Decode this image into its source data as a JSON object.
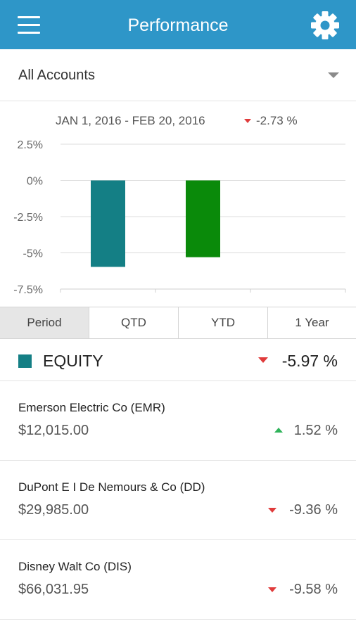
{
  "header": {
    "title": "Performance",
    "menu_icon": "hamburger-menu-icon",
    "settings_icon": "gear-icon",
    "bar_color": "#2e96c8"
  },
  "account_selector": {
    "selected": "All Accounts"
  },
  "summary": {
    "date_range": "JAN 1, 2016 - FEB 20, 2016",
    "change": "-2.73 %",
    "direction": "down"
  },
  "chart_data": {
    "type": "bar",
    "categories": [
      "",
      "",
      ""
    ],
    "values": [
      -5.97,
      -5.3,
      null
    ],
    "colors": [
      "#147f85",
      "#0a8a0a",
      null
    ],
    "ylim": [
      -7.5,
      2.5
    ],
    "yticks": [
      2.5,
      0,
      -2.5,
      -5,
      -7.5
    ],
    "ytick_labels": [
      "2.5%",
      "0%",
      "-2.5%",
      "-5%",
      "-7.5%"
    ],
    "grid": true,
    "xlabel": "",
    "ylabel": ""
  },
  "period_tabs": [
    {
      "label": "Period",
      "active": true
    },
    {
      "label": "QTD",
      "active": false
    },
    {
      "label": "YTD",
      "active": false
    },
    {
      "label": "1 Year",
      "active": false
    }
  ],
  "equity": {
    "label": "EQUITY",
    "change": "-5.97 %",
    "direction": "down",
    "color": "#147f85"
  },
  "holdings": [
    {
      "name": "Emerson Electric Co (EMR)",
      "value": "$12,015.00",
      "change": "1.52 %",
      "direction": "up"
    },
    {
      "name": "DuPont E I De Nemours & Co (DD)",
      "value": "$29,985.00",
      "change": "-9.36 %",
      "direction": "down"
    },
    {
      "name": "Disney Walt Co (DIS)",
      "value": "$66,031.95",
      "change": "-9.58 %",
      "direction": "down"
    }
  ]
}
